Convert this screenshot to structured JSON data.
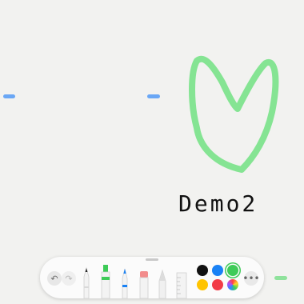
{
  "canvas": {
    "text": "Demo2",
    "stroke_color": "#7ee38d",
    "marks": [
      {
        "color": "#6aa7f5"
      },
      {
        "color": "#6aa7f5"
      },
      {
        "color": "#8fe29c"
      }
    ]
  },
  "toolbar": {
    "undo_icon": "undo-icon",
    "redo_icon": "redo-icon",
    "tools": [
      "pen",
      "highlighter",
      "pencil",
      "eraser",
      "lasso",
      "ruler"
    ],
    "colors": [
      {
        "name": "black",
        "hex": "#111111"
      },
      {
        "name": "blue",
        "hex": "#1a82f5"
      },
      {
        "name": "green",
        "hex": "#3ecb58",
        "selected": true
      },
      {
        "name": "yellow",
        "hex": "#ffc400"
      },
      {
        "name": "red",
        "hex": "#f23b46"
      },
      {
        "name": "custom",
        "icon": "color-wheel-icon"
      }
    ],
    "more_label": "•••"
  }
}
